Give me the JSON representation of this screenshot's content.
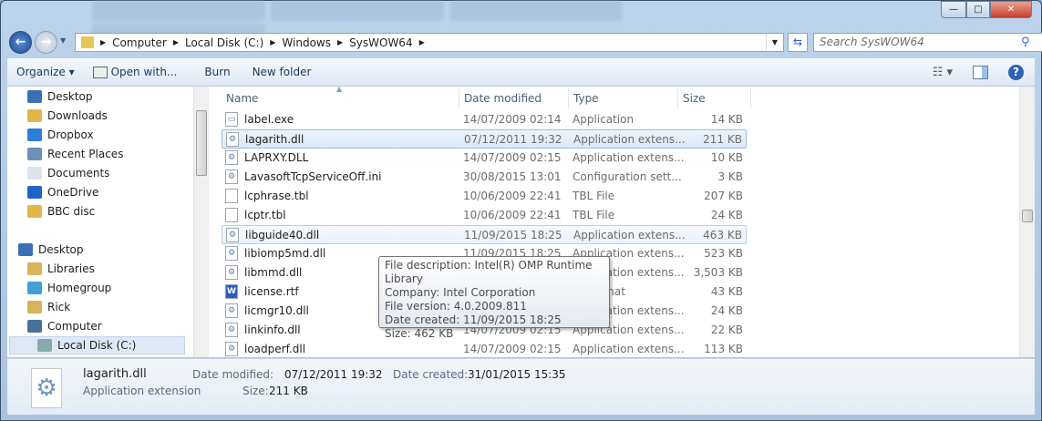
{
  "window": {
    "minimize": "—",
    "maximize": "□",
    "close": "✕"
  },
  "address": {
    "crumbs": [
      "Computer",
      "Local Disk (C:)",
      "Windows",
      "SysWOW64"
    ],
    "search_placeholder": "Search SysWOW64"
  },
  "toolbar": {
    "organize": "Organize ▾",
    "open_with": "Open with...",
    "burn": "Burn",
    "new_folder": "New folder",
    "views_icon": "views-icon",
    "preview_icon": "preview-pane-icon",
    "help": "?"
  },
  "nav": {
    "favorites": [
      "Desktop",
      "Downloads",
      "Dropbox",
      "Recent Places",
      "Documents",
      "OneDrive",
      "BBC disc"
    ],
    "tree": [
      "Desktop",
      "Libraries",
      "Homegroup",
      "Rick",
      "Computer"
    ],
    "selected": "Local Disk (C:)"
  },
  "columns": {
    "name": "Name",
    "date": "Date modified",
    "type": "Type",
    "size": "Size"
  },
  "files": [
    {
      "name": "label.exe",
      "date": "14/07/2009 02:14",
      "type": "Application",
      "size": "14 KB",
      "icon": "exe"
    },
    {
      "name": "lagarith.dll",
      "date": "07/12/2011 19:32",
      "type": "Application extens...",
      "size": "211 KB",
      "icon": "dll",
      "state": "selected"
    },
    {
      "name": "LAPRXY.DLL",
      "date": "14/07/2009 02:15",
      "type": "Application extens...",
      "size": "10 KB",
      "icon": "dll"
    },
    {
      "name": "LavasoftTcpServiceOff.ini",
      "date": "30/08/2015 13:01",
      "type": "Configuration sett...",
      "size": "3 KB",
      "icon": "ini"
    },
    {
      "name": "lcphrase.tbl",
      "date": "10/06/2009 22:41",
      "type": "TBL File",
      "size": "207 KB",
      "icon": "file"
    },
    {
      "name": "lcptr.tbl",
      "date": "10/06/2009 22:41",
      "type": "TBL File",
      "size": "24 KB",
      "icon": "file"
    },
    {
      "name": "libguide40.dll",
      "date": "11/09/2015 18:25",
      "type": "Application extens...",
      "size": "463 KB",
      "icon": "dll",
      "state": "hover"
    },
    {
      "name": "libiomp5md.dll",
      "date": "11/09/2015 18:25",
      "type": "Application extens...",
      "size": "523 KB",
      "icon": "dll"
    },
    {
      "name": "libmmd.dll",
      "date": "",
      "type": "Application extens...",
      "size": "3,503 KB",
      "icon": "dll"
    },
    {
      "name": "license.rtf",
      "date": "",
      "type": "xt Format",
      "size": "43 KB",
      "icon": "word"
    },
    {
      "name": "licmgr10.dll",
      "date": "",
      "type": "Application extens...",
      "size": "24 KB",
      "icon": "dll"
    },
    {
      "name": "linkinfo.dll",
      "date": "14/07/2009 02:15",
      "type": "Application extens...",
      "size": "22 KB",
      "icon": "dll"
    },
    {
      "name": "loadperf.dll",
      "date": "14/07/2009 02:15",
      "type": "Application extens...",
      "size": "113 KB",
      "icon": "dll"
    }
  ],
  "tooltip": [
    "File description: Intel(R) OMP Runtime Library",
    "Company: Intel Corporation",
    "File version: 4.0.2009.811",
    "Date created: 11/09/2015 18:25",
    "Size: 462 KB"
  ],
  "details": {
    "name": "lagarith.dll",
    "type": "Application extension",
    "date_modified_label": "Date modified:",
    "date_modified": "07/12/2011 19:32",
    "size_label": "Size:",
    "size": "211 KB",
    "date_created_label": "Date created:",
    "date_created": "31/01/2015 15:35"
  }
}
